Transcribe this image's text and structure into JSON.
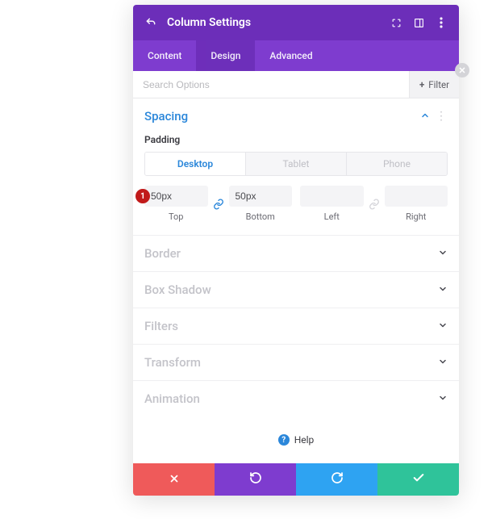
{
  "header": {
    "title": "Column Settings"
  },
  "tabs": {
    "content": "Content",
    "design": "Design",
    "advanced": "Advanced",
    "active": "design"
  },
  "search": {
    "placeholder": "Search Options",
    "filter_label": "Filter"
  },
  "spacing": {
    "title": "Spacing",
    "padding_label": "Padding",
    "device_tabs": {
      "desktop": "Desktop",
      "tablet": "Tablet",
      "phone": "Phone",
      "active": "desktop"
    },
    "padding": {
      "top": {
        "value": "50px",
        "label": "Top"
      },
      "bottom": {
        "value": "50px",
        "label": "Bottom"
      },
      "left": {
        "value": "",
        "label": "Left"
      },
      "right": {
        "value": "",
        "label": "Right"
      }
    },
    "callout_number": "1"
  },
  "sections": {
    "border": "Border",
    "box_shadow": "Box Shadow",
    "filters": "Filters",
    "transform": "Transform",
    "animation": "Animation"
  },
  "help_label": "Help",
  "colors": {
    "header_bg": "#6c2eb9",
    "tabbar_bg": "#7e3ccf",
    "accent_blue": "#2b87da",
    "footer_red": "#ef5a5a",
    "footer_purple": "#7e3ccf",
    "footer_blue": "#2ea3f2",
    "footer_green": "#2fc39a",
    "callout_red": "#c11a1a"
  }
}
